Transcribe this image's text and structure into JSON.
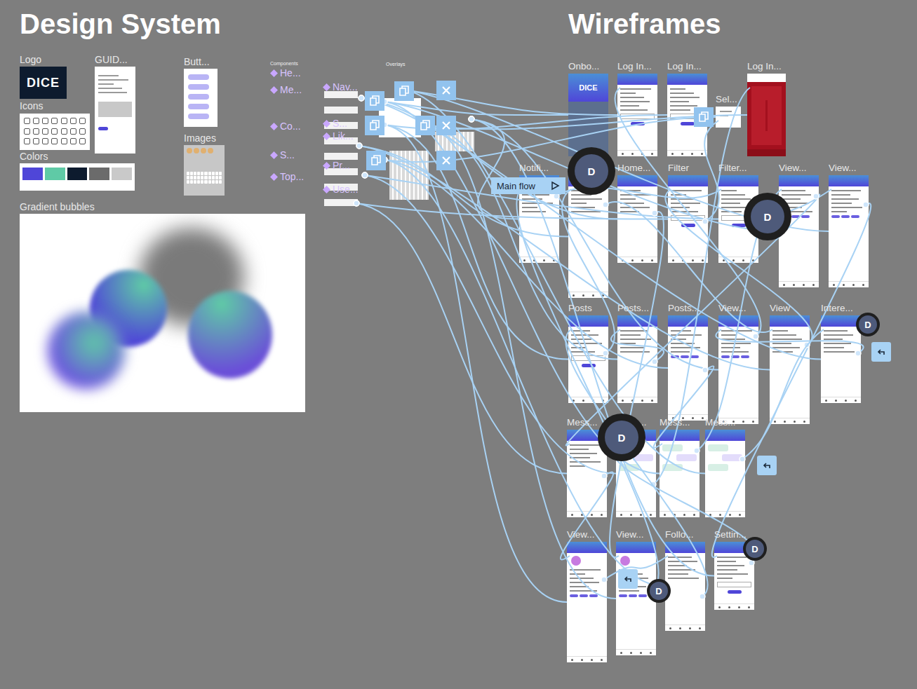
{
  "sections": [
    {
      "title": "Design System"
    },
    {
      "title": "Wireframes"
    }
  ],
  "design_system": {
    "logo": {
      "label": "Logo",
      "text": "DICE"
    },
    "guide": {
      "label": "GUID..."
    },
    "buttons": {
      "label": "Butt..."
    },
    "icons": {
      "label": "Icons"
    },
    "images": {
      "label": "Images"
    },
    "colors": {
      "label": "Colors",
      "swatches": [
        {
          "color": "#4f46d8"
        },
        {
          "color": "#5fcaa6"
        },
        {
          "color": "#0d1b2e"
        },
        {
          "color": "#6b6b6b"
        },
        {
          "color": "#c9c9c9"
        }
      ]
    },
    "gradient": {
      "label": "Gradient bubbles"
    },
    "components": {
      "label": "Components",
      "items": [
        "He...",
        "Me...",
        "Co...",
        "S...",
        "Top..."
      ]
    },
    "nav_components": [
      "Nav...",
      "S...",
      "Lik...",
      "Pr...",
      "Use..."
    ],
    "overlays": {
      "label": "Overlays"
    }
  },
  "flow_start": {
    "label": "Main flow"
  },
  "frames": [
    {
      "label": "Onbo...",
      "kind": "onboarding",
      "text": "DICE"
    },
    {
      "label": "Log In...",
      "kind": "form"
    },
    {
      "label": "Log In...",
      "kind": "form"
    },
    {
      "label": "Log In...",
      "kind": "usc"
    },
    {
      "label": "Sel...",
      "kind": "note"
    },
    {
      "label": "Notifi...",
      "kind": "list"
    },
    {
      "kind": "list"
    },
    {
      "label": "Home...",
      "kind": "list"
    },
    {
      "label": "Filter",
      "kind": "form"
    },
    {
      "label": "Filter...",
      "kind": "form"
    },
    {
      "label": "View...",
      "kind": "post"
    },
    {
      "label": "View...",
      "kind": "post"
    },
    {
      "label": "Posts",
      "kind": "form"
    },
    {
      "label": "Posts...",
      "kind": "keyboard"
    },
    {
      "label": "Posts...",
      "kind": "post"
    },
    {
      "label": "View...",
      "kind": "post"
    },
    {
      "label": "View",
      "kind": "keyboard"
    },
    {
      "label": "Intere...",
      "kind": "list"
    },
    {
      "label": "Mess...",
      "kind": "list"
    },
    {
      "label": "Mess...",
      "kind": "chat"
    },
    {
      "label": "Mess...",
      "kind": "chat"
    },
    {
      "label": "Mess...",
      "kind": "chat"
    },
    {
      "label": "View...",
      "kind": "profile"
    },
    {
      "label": "View...",
      "kind": "profile"
    },
    {
      "label": "Follo...",
      "kind": "list"
    },
    {
      "label": "Settin...",
      "kind": "form"
    }
  ],
  "comments": [
    {
      "initial": "D",
      "kind": "large"
    },
    {
      "initial": "D",
      "kind": "large"
    },
    {
      "initial": "D",
      "kind": "large"
    },
    {
      "initial": "D",
      "kind": "small"
    },
    {
      "initial": "D",
      "kind": "small"
    },
    {
      "initial": "D",
      "kind": "small"
    }
  ]
}
